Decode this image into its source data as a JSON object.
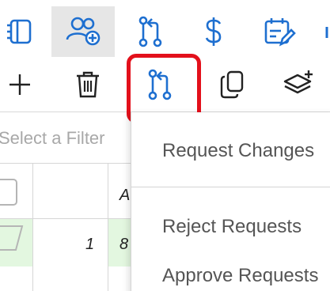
{
  "colors": {
    "icon_blue": "#1e6fd0",
    "highlight_red": "#e3101b",
    "active_tab_bg": "#e6e6e6",
    "row_green": "#e3f7e0",
    "menu_text": "#555555"
  },
  "topnav": {
    "items": [
      {
        "icon": "sidebar-book-icon"
      },
      {
        "icon": "users-add-icon",
        "active": true
      },
      {
        "icon": "pull-request-icon"
      },
      {
        "icon": "dollar-icon"
      },
      {
        "icon": "calendar-edit-icon"
      }
    ]
  },
  "toolbar": {
    "items": [
      {
        "icon": "plus-icon"
      },
      {
        "icon": "trash-icon"
      },
      {
        "icon": "pull-request-icon",
        "highlighted": true
      },
      {
        "icon": "copy-icon"
      },
      {
        "icon": "layers-add-icon"
      }
    ]
  },
  "filter": {
    "placeholder": "Select a Filter"
  },
  "grid": {
    "header_col_a": "A",
    "row_number": "1",
    "row_value": "8"
  },
  "menu": {
    "items": [
      {
        "label": "Request Changes"
      },
      {
        "label": "Reject Requests"
      },
      {
        "label": "Approve Requests"
      }
    ]
  }
}
